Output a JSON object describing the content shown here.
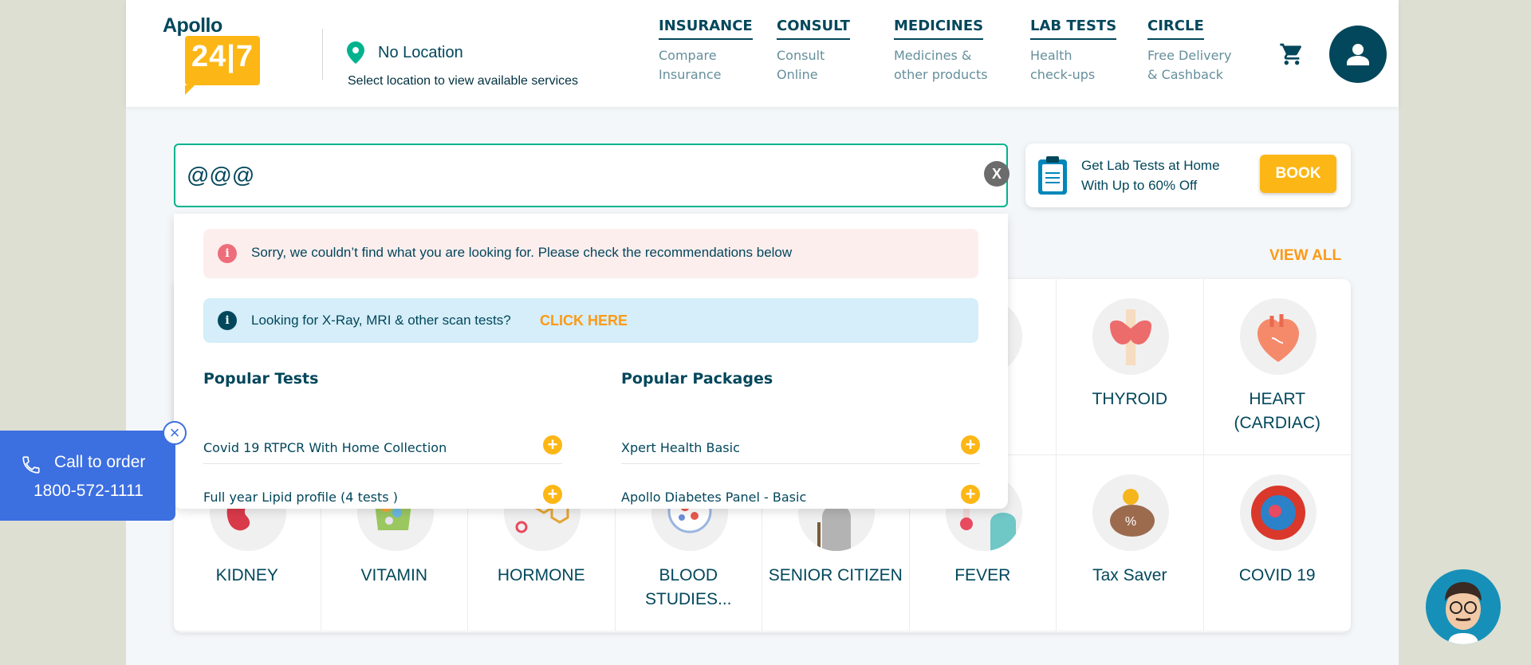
{
  "brand": {
    "name": "Apollo",
    "badge": "24|7"
  },
  "location": {
    "title": "No Location",
    "subtitle": "Select location to view available services"
  },
  "nav": [
    {
      "title": "INSURANCE",
      "sub": "Compare\nInsurance"
    },
    {
      "title": "CONSULT",
      "sub": "Consult\nOnline"
    },
    {
      "title": "MEDICINES",
      "sub": "Medicines &\nother products"
    },
    {
      "title": "LAB TESTS",
      "sub": "Health\ncheck-ups"
    },
    {
      "title": "CIRCLE",
      "sub": "Free Delivery\n& Cashback"
    }
  ],
  "icons": {
    "cart": "cart-icon",
    "user": "user-icon",
    "location": "location-pin-icon",
    "clear": "clear-icon",
    "phone": "phone-icon",
    "close": "close-icon",
    "info": "info-icon",
    "plus": "plus-icon"
  },
  "search": {
    "value": "@@@",
    "clear_label": "X"
  },
  "promo": {
    "text": "Get Lab Tests at Home With Up to 60% Off",
    "button": "BOOK"
  },
  "view_all": "VIEW ALL",
  "categories_row1": [
    "",
    "",
    "",
    "",
    "",
    "",
    "THYROID",
    "HEART (CARDIAC)"
  ],
  "categories_row2": [
    "KIDNEY",
    "VITAMIN",
    "HORMONE",
    "BLOOD STUDIES...",
    "SENIOR CITIZEN",
    "FEVER",
    "Tax Saver",
    "COVID 19"
  ],
  "dropdown": {
    "error_icon": "i",
    "error": "Sorry, we couldn’t find what you are looking for. Please check the recommendations below",
    "info_icon": "i",
    "info": "Looking for X-Ray, MRI & other scan tests?",
    "info_link": "CLICK HERE",
    "popular_tests_title": "Popular Tests",
    "popular_tests": [
      "Covid 19 RTPCR With Home Collection",
      "Full year Lipid profile (4 tests )"
    ],
    "popular_packages_title": "Popular Packages",
    "popular_packages": [
      "Xpert Health Basic",
      "Apollo Diabetes Panel - Basic"
    ],
    "add_label": "+"
  },
  "call": {
    "label": "Call to order",
    "number": "1800-572-1111",
    "close": "×"
  },
  "colors": {
    "primary": "#02475b",
    "accent": "#fcb716",
    "orange": "#fc9916",
    "green": "#00b38e",
    "call_blue": "#3c6fe0"
  }
}
